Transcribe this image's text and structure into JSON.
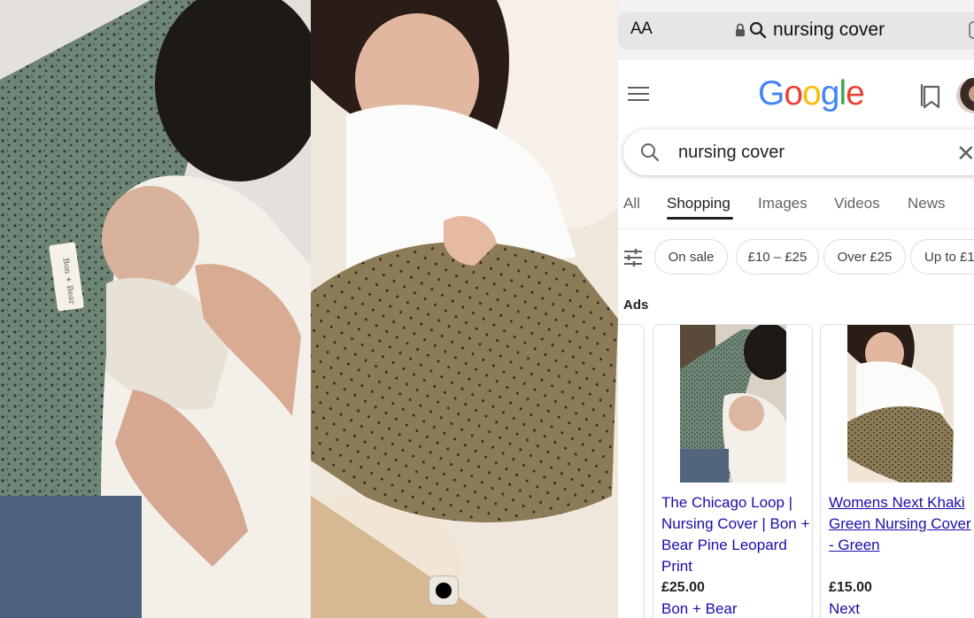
{
  "browser": {
    "text_size_label": "AA",
    "url_query": "nursing cover"
  },
  "google": {
    "logo_letters": [
      "G",
      "o",
      "o",
      "g",
      "l",
      "e"
    ],
    "search_query": "nursing cover",
    "tabs": [
      "All",
      "Shopping",
      "Images",
      "Videos",
      "News"
    ],
    "active_tab": "Shopping",
    "filter_chips": [
      "On sale",
      "£10 – £25",
      "Over £25",
      "Up to £1"
    ],
    "ads_label": "Ads",
    "products": [
      {
        "title": "The Chicago Loop | Nursing Cover | Bon + Bear Pine Leopard Print",
        "price": "£25.00",
        "seller": "Bon + Bear"
      },
      {
        "title": "Womens Next Khaki Green Nursing Cover - Green",
        "price": "£15.00",
        "seller": "Next"
      }
    ]
  },
  "colors": {
    "google_blue": "#4285f4",
    "google_red": "#ea4335",
    "google_yellow": "#fbbc05",
    "google_green": "#34a853",
    "link_blue": "#1a0dab"
  },
  "icons": [
    "lock-icon",
    "search-icon",
    "microphone-icon",
    "menu-icon",
    "bookmark-icon",
    "clear-icon",
    "filter-icon",
    "record-icon"
  ]
}
